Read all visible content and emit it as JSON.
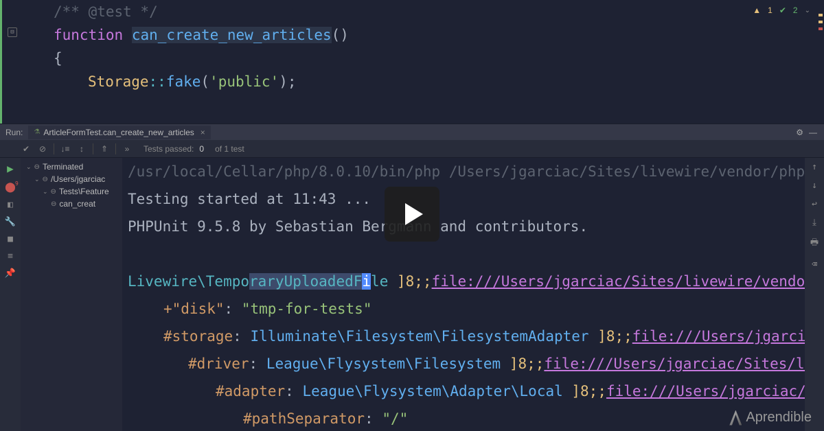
{
  "inspections": {
    "warnings": "1",
    "checks": "2"
  },
  "editor": {
    "comment": "/** @test */",
    "keyword": "function",
    "funcName": "can_create_new_articles",
    "parens": "()",
    "brace": "{",
    "storageClass": "Storage",
    "doubleColon": "::",
    "fakeMethod": "fake",
    "openParen": "(",
    "stringPublic": "'public'",
    "closeParen": ");"
  },
  "runBar": {
    "label": "Run:",
    "tabLabel": "ArticleFormTest.can_create_new_articles"
  },
  "toolRow": {
    "testsLabel": "Tests passed:",
    "testsPassed": "0",
    "testsOf": "of 1 test"
  },
  "tree": {
    "root": "Terminated",
    "path": "/Users/jgarciac",
    "suite": "Tests\\Feature",
    "test": "can_creat"
  },
  "console": {
    "path": "/usr/local/Cellar/php/8.0.10/bin/php /Users/jgarciac/Sites/livewire/vendor/php",
    "started": "Testing started at 11:43 ...",
    "phpunit": "PHPUnit 9.5.8 by Sebastian Bergmann and contributors.",
    "livewirePre": "Livewire\\Tempo",
    "livewireHL": "raryUploadedF",
    "livewireCursor": "i",
    "livewirePost": "le",
    "brack": " ]8;;",
    "link1": "file:///Users/jgarciac/Sites/livewire/vendo",
    "diskKey": "+\"disk\"",
    "colon": ": ",
    "diskVal": "\"tmp-for-tests\"",
    "storageKey": "#storage",
    "storageVal": "Illuminate\\Filesystem\\FilesystemAdapter",
    "link2": "file:///Users/jgarciac",
    "driverKey": "#driver",
    "driverVal": "League\\Flysystem\\Filesystem",
    "link3": "file:///Users/jgarciac/Sites/live",
    "adapterKey": "#adapter",
    "adapterVal": "League\\Flysystem\\Adapter\\Local",
    "link4": "file:///Users/jgarciac/Site",
    "pathSepKey": "#pathSeparator",
    "pathSepVal": "\"/\""
  },
  "watermark": "Aprendible"
}
